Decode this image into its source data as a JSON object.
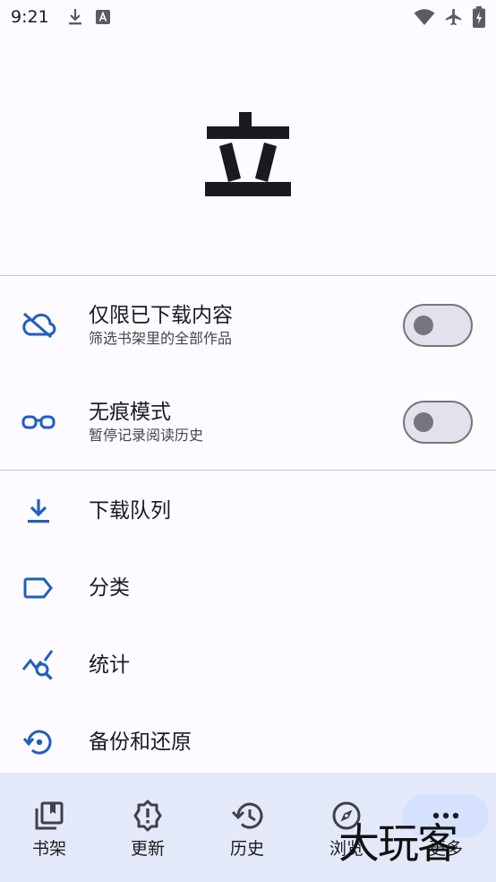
{
  "status_bar": {
    "time": "9:21",
    "icons_left": [
      "download-icon",
      "a-box-icon"
    ],
    "icons_right": [
      "wifi-icon",
      "airplane-icon",
      "battery-charging-icon"
    ]
  },
  "logo": {
    "icon": "li-logo-icon"
  },
  "toggles": [
    {
      "title": "仅限已下载内容",
      "subtitle": "筛选书架里的全部作品",
      "icon": "cloud-off-icon",
      "on": false
    },
    {
      "title": "无痕模式",
      "subtitle": "暂停记录阅读历史",
      "icon": "glasses-icon",
      "on": false
    }
  ],
  "menu": [
    {
      "label": "下载队列",
      "icon": "download-queue-icon"
    },
    {
      "label": "分类",
      "icon": "label-icon"
    },
    {
      "label": "统计",
      "icon": "query-stats-icon"
    },
    {
      "label": "备份和还原",
      "icon": "settings-backup-restore-icon"
    }
  ],
  "bottom_nav": [
    {
      "label": "书架",
      "icon": "library-books-icon",
      "active": false
    },
    {
      "label": "更新",
      "icon": "new-releases-icon",
      "active": false
    },
    {
      "label": "历史",
      "icon": "history-icon",
      "active": false
    },
    {
      "label": "浏览",
      "icon": "explore-icon",
      "active": false
    },
    {
      "label": "更多",
      "icon": "more-horiz-icon",
      "active": true
    }
  ],
  "watermark": "大玩客",
  "colors": {
    "accent": "#1f5fbf",
    "background": "#fdfbff",
    "nav_background": "#e3e9f8",
    "nav_active": "#d5e1ff"
  }
}
